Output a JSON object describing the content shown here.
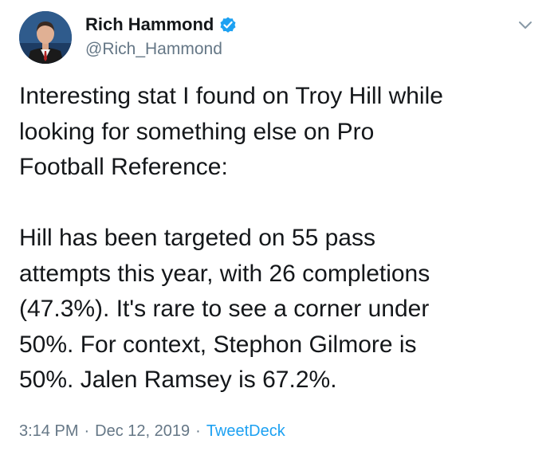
{
  "author": {
    "display_name": "Rich Hammond",
    "handle": "@Rich_Hammond",
    "verified": true
  },
  "tweet": {
    "paragraphs": [
      "Interesting stat I found on Troy Hill while\nlooking for something else on Pro\nFootball Reference:",
      "Hill has been targeted on 55 pass\nattempts this year, with 26 completions\n(47.3%). It's rare to see a corner under\n50%. For context, Stephon Gilmore is\n50%. Jalen Ramsey is 67.2%."
    ]
  },
  "meta": {
    "time": "3:14 PM",
    "separator": "·",
    "date": "Dec 12, 2019",
    "source": "TweetDeck"
  },
  "colors": {
    "text": "#14171a",
    "secondary": "#657786",
    "accent": "#1da1f2"
  },
  "icons": [
    "verified-badge-icon",
    "chevron-down-icon"
  ]
}
